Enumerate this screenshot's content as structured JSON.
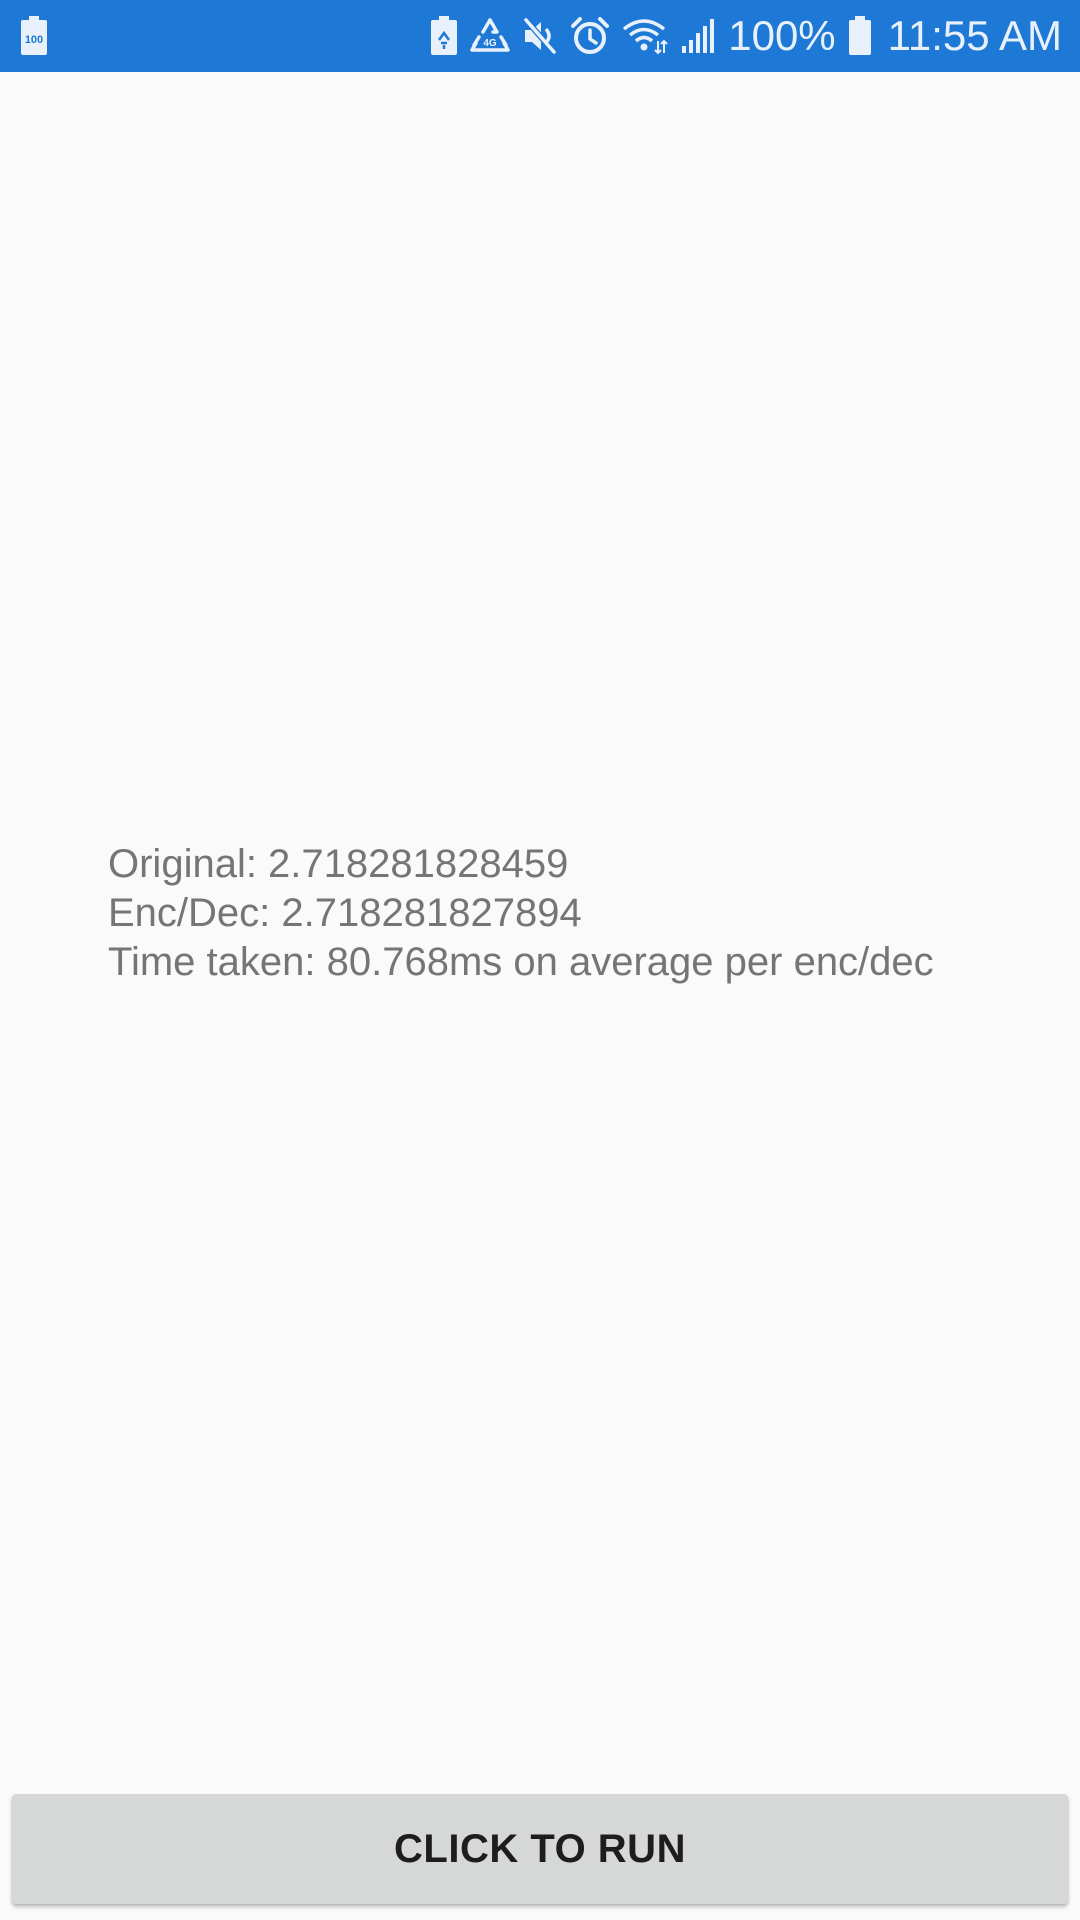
{
  "status_bar": {
    "background": "#1e78d5",
    "left_icons": [
      "battery-100-icon"
    ],
    "left_badge_text": "100",
    "right_icons": [
      "battery-saver-icon",
      "recycle-icon",
      "mute-icon",
      "alarm-icon",
      "wifi-icon",
      "signal-icon",
      "battery-icon"
    ],
    "battery_percent": "100%",
    "time": "11:55 AM"
  },
  "results": {
    "original": "Original: 2.718281828459",
    "enc_dec": "Enc/Dec: 2.718281827894",
    "time_taken": "Time taken: 80.768ms on average per enc/dec",
    "text_color": "#757575"
  },
  "action": {
    "run_label": "CLICK TO RUN",
    "button_color": "#d6d7d7"
  }
}
